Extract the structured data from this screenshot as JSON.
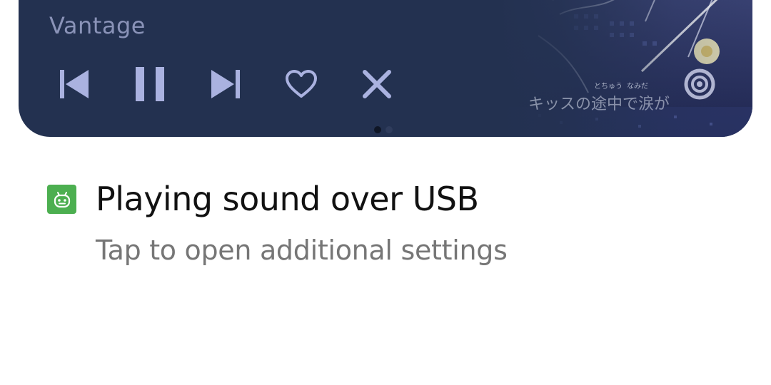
{
  "media_player": {
    "artist": "Vantage",
    "lyric_line": "キッスの途中で涙が",
    "lyric_ruby_1": "とちゅう",
    "lyric_ruby_2": "なみだ",
    "controls": {
      "previous_icon": "skip-previous-icon",
      "pause_icon": "pause-icon",
      "next_icon": "skip-next-icon",
      "like_icon": "heart-outline-icon",
      "close_icon": "close-icon"
    },
    "output_icon": "audio-output-icon",
    "page_indicator": {
      "count": 2,
      "active_index": 0
    },
    "colors": {
      "card_background": "#233150",
      "control_color": "#aab2e0"
    }
  },
  "notification": {
    "app_icon": "android-icon",
    "title": "Playing sound over USB",
    "subtitle": "Tap to open additional settings",
    "colors": {
      "app_icon_background": "#4caf50"
    }
  }
}
